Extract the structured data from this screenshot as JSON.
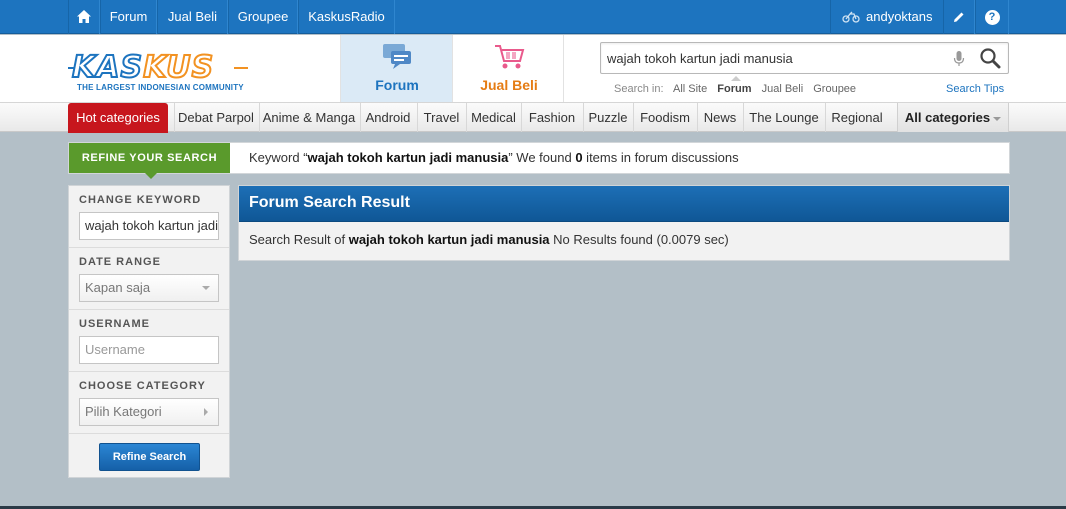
{
  "topbar": {
    "nav": [
      "Forum",
      "Jual Beli",
      "Groupee",
      "KaskusRadio"
    ],
    "username": "andyoktans"
  },
  "logo": {
    "wordmark_a": "KAS",
    "wordmark_b": "KUS",
    "tagline": "THE LARGEST INDONESIAN COMMUNITY"
  },
  "header_tabs": {
    "forum": "Forum",
    "jual_beli": "Jual Beli"
  },
  "search": {
    "value": "wajah tokoh kartun jadi manusia",
    "search_in_label": "Search in:",
    "options": [
      "All Site",
      "Forum",
      "Jual Beli",
      "Groupee"
    ],
    "selected": "Forum",
    "tips": "Search Tips"
  },
  "categories": {
    "hot": "Hot categories",
    "items": [
      "Debat Parpol",
      "Anime & Manga",
      "Android",
      "Travel",
      "Medical",
      "Fashion",
      "Puzzle",
      "Foodism",
      "News",
      "The Lounge",
      "Regional"
    ],
    "all": "All categories"
  },
  "refine_bar": {
    "tag": "REFINE YOUR SEARCH",
    "msg_prefix": "Keyword “",
    "keyword": "wajah tokoh kartun jadi manusia",
    "msg_mid": "” We found ",
    "count": "0",
    "msg_suffix": " items in forum discussions"
  },
  "sidebar": {
    "change_keyword": {
      "label": "CHANGE KEYWORD",
      "value": "wajah tokoh kartun jadi manusia"
    },
    "date_range": {
      "label": "DATE RANGE",
      "value": "Kapan saja"
    },
    "username": {
      "label": "USERNAME",
      "placeholder": "Username"
    },
    "category": {
      "label": "CHOOSE CATEGORY",
      "value": "Pilih Kategori"
    },
    "button": "Refine Search"
  },
  "result": {
    "title": "Forum Search Result",
    "prefix": "Search Result of ",
    "keyword": "wajah tokoh kartun jadi manusia",
    "suffix": " No Results found (0.0079 sec)"
  },
  "colors": {
    "brand_blue": "#1d74bf",
    "brand_orange": "#f29222",
    "hot_red": "#c7161d",
    "refine_green": "#5a9a2c"
  }
}
